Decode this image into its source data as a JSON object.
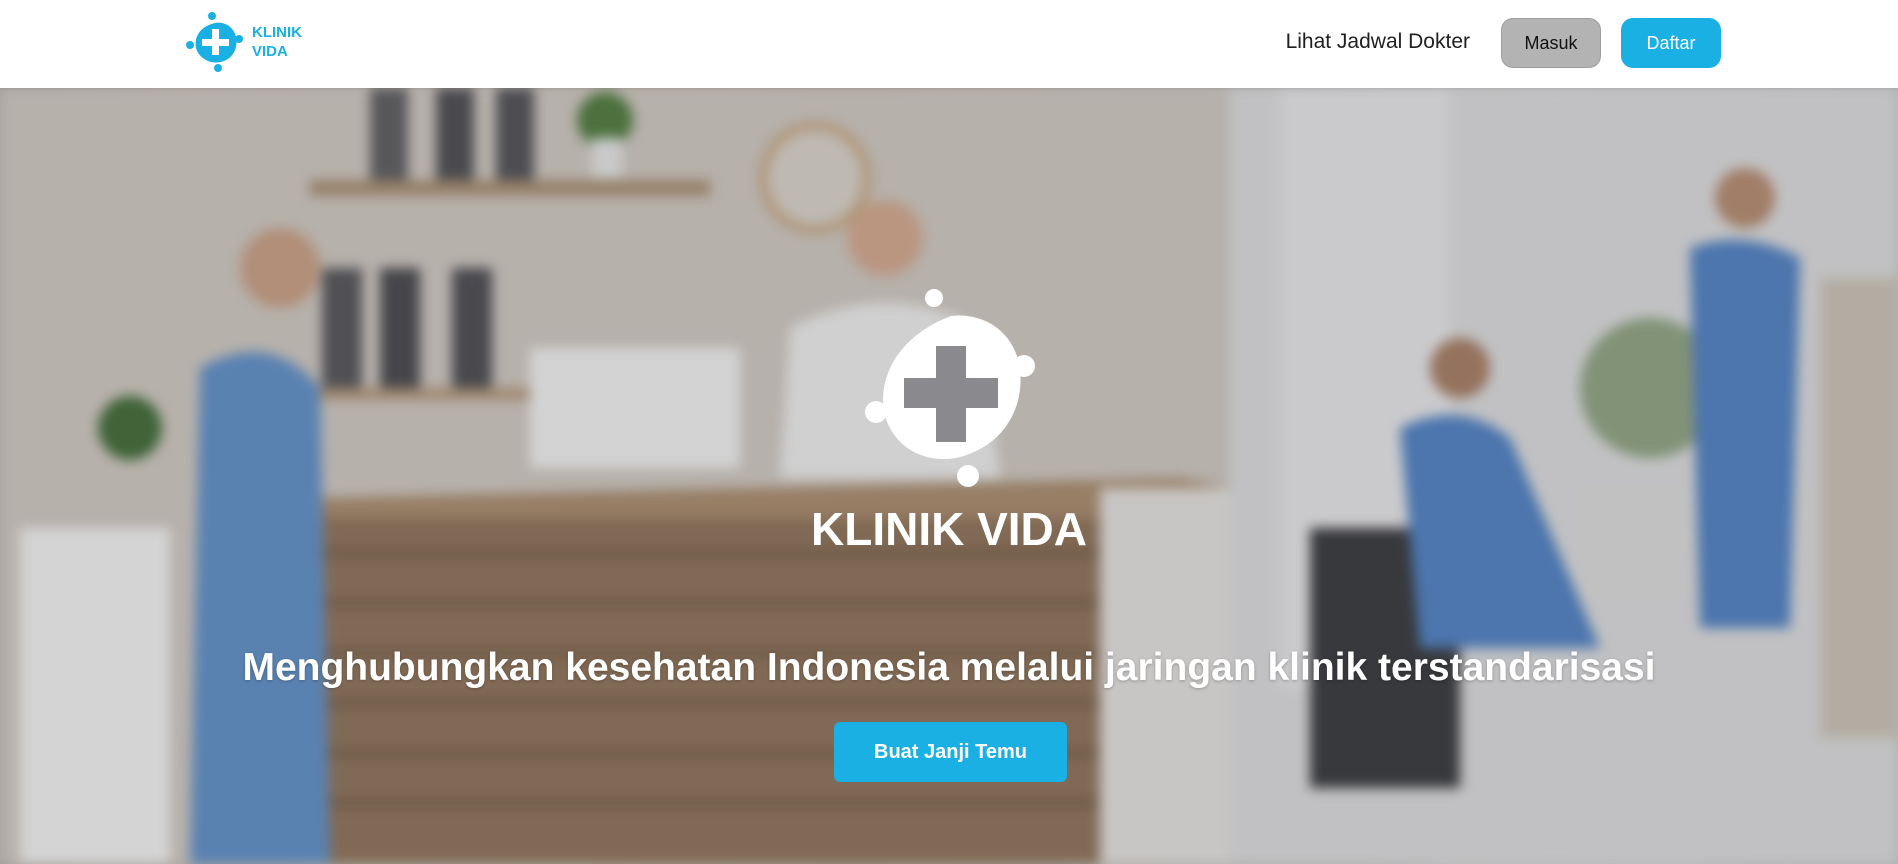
{
  "navbar": {
    "brand_line1": "KLINIK",
    "brand_line2": "VIDA",
    "schedule_link": "Lihat Jadwal Dokter",
    "login_label": "Masuk",
    "register_label": "Daftar"
  },
  "hero": {
    "brand_name": "KLINIK VIDA",
    "tagline": "Menghubungkan kesehatan Indonesia melalui jaringan klinik terstandarisasi",
    "cta_label": "Buat Janji Temu"
  },
  "colors": {
    "brand_blue": "#1ab0e3",
    "login_gray": "#b3b3b3",
    "navbar_bg": "#ffffff"
  },
  "icons": {
    "brand_logo": "cross-with-people-logo",
    "hero_logo": "cross-with-people-logo"
  }
}
